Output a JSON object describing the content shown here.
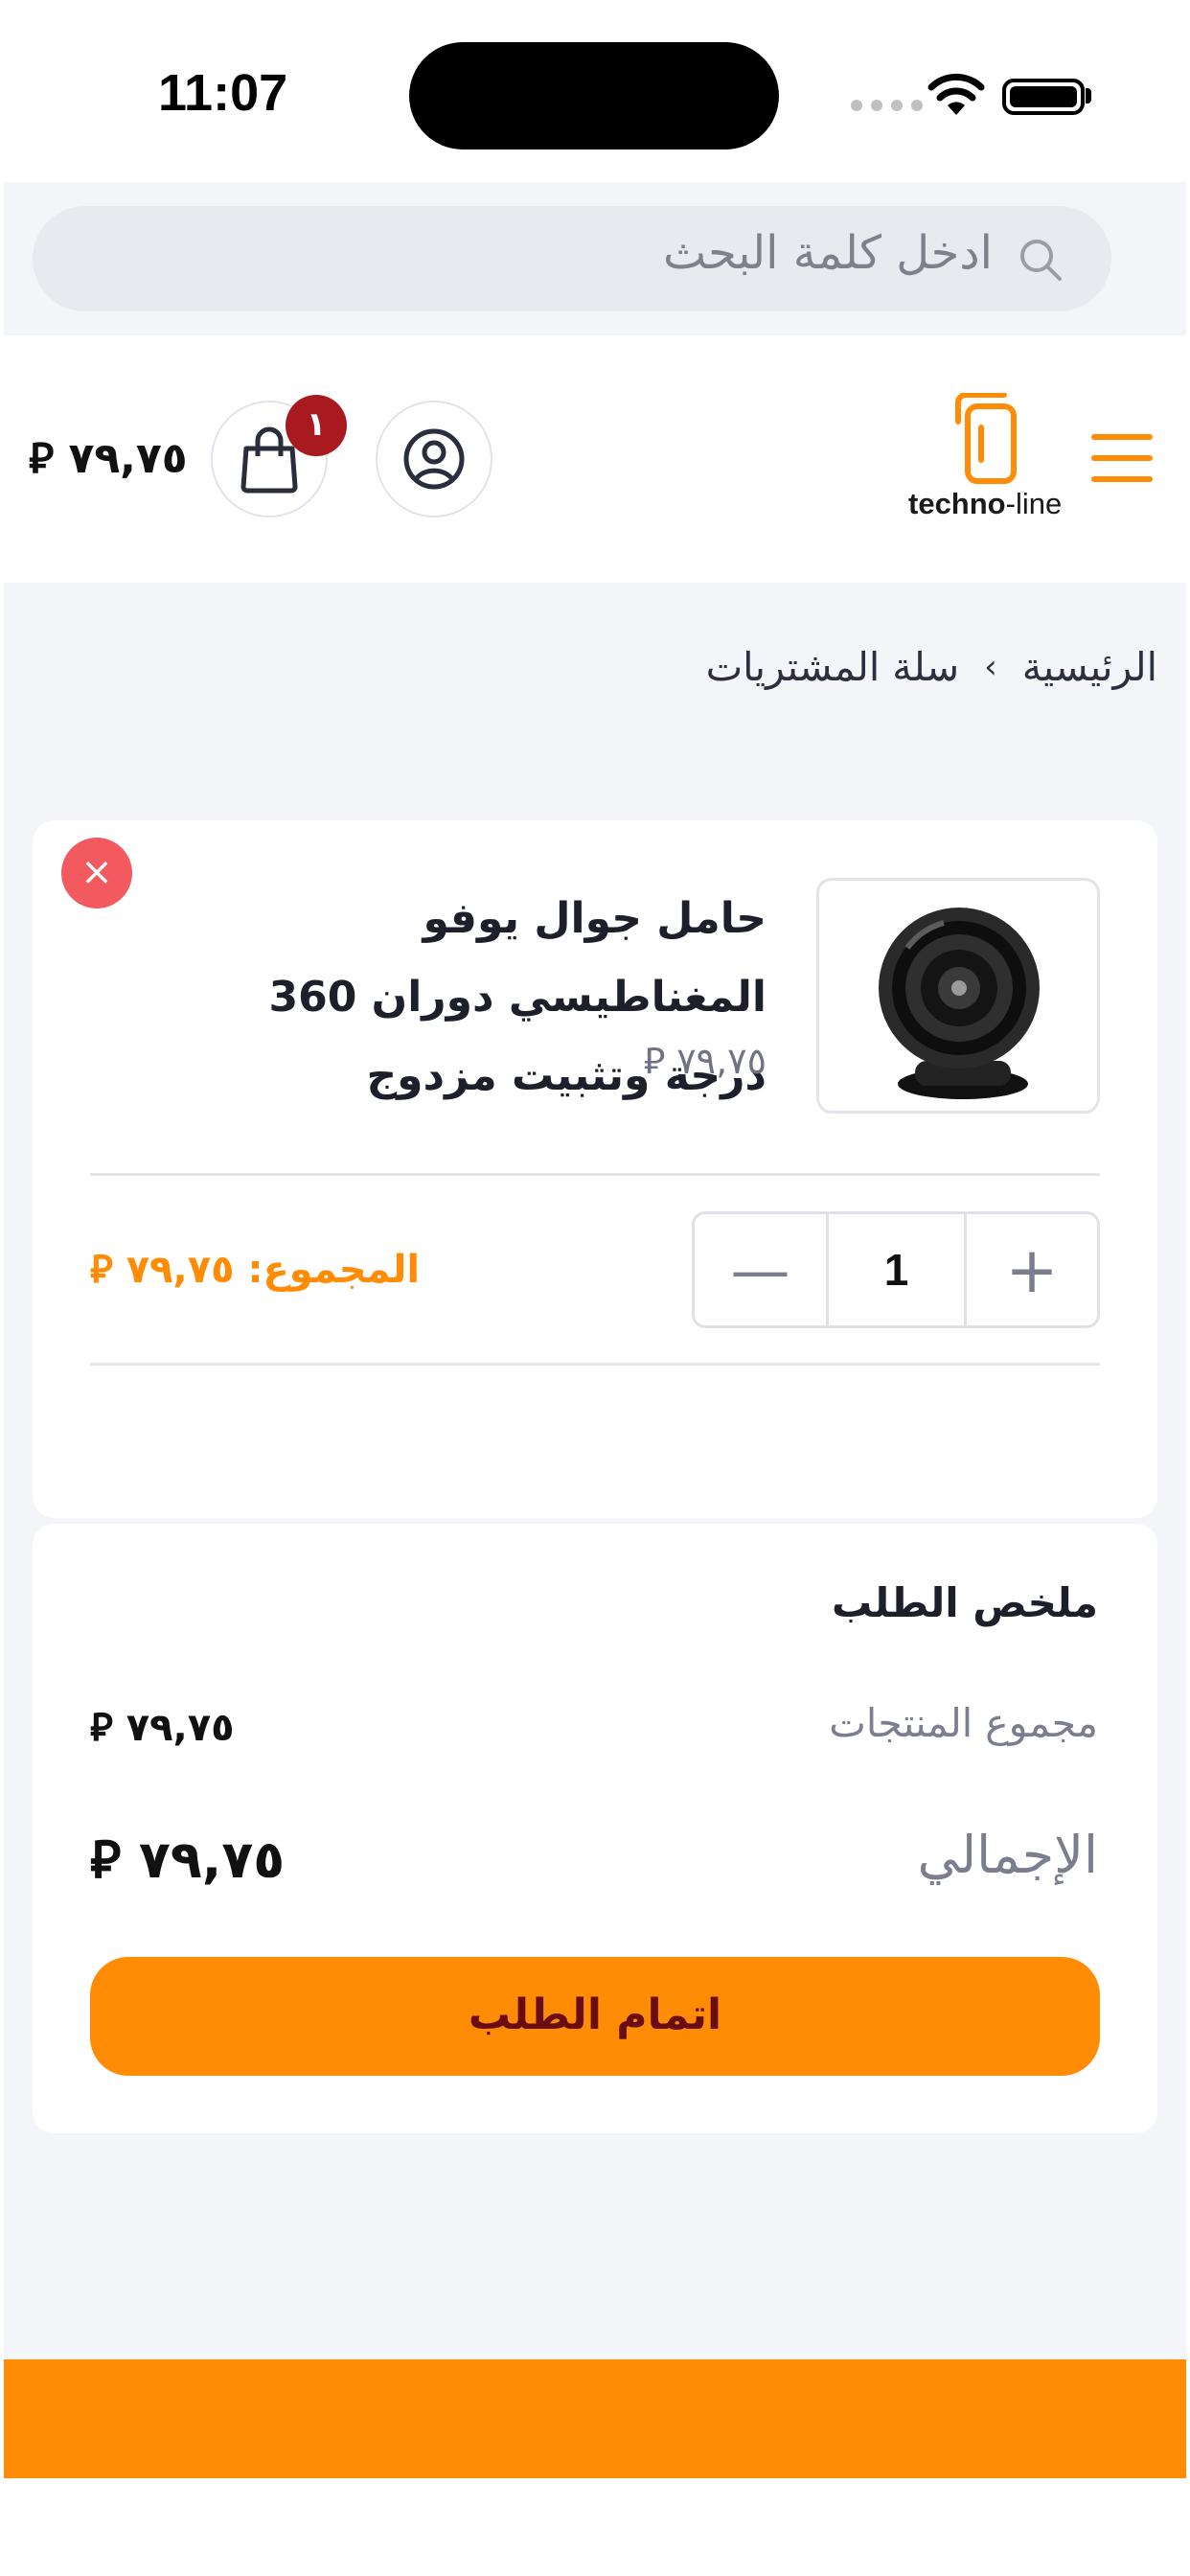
{
  "status_bar": {
    "time": "11:07"
  },
  "search": {
    "placeholder": "ادخل كلمة البحث"
  },
  "header": {
    "logo_brand": "techno",
    "logo_suffix": "-line",
    "cart_count": "١",
    "cart_total": "٧٩,٧٥ ⃁"
  },
  "breadcrumb": {
    "home": "الرئيسية",
    "separator": "›",
    "current": "سلة المشتريات"
  },
  "cart": {
    "remove_symbol": "×",
    "item": {
      "name": "حامل جوال يوفو المغناطيسي دوران 360 درجة وتثبيت مزدوج",
      "price": "٧٩,٧٥ ⃁",
      "quantity": "1",
      "line_total": "المجموع: ٧٩,٧٥ ⃁"
    },
    "minus_symbol": "—",
    "plus_symbol": "+"
  },
  "summary": {
    "title": "ملخص الطلب",
    "subtotal_label": "مجموع المنتجات",
    "subtotal_value": "٧٩,٧٥ ⃁",
    "total_label": "الإجمالي",
    "total_value": "٧٩,٧٥ ⃁",
    "checkout_label": "اتمام الطلب"
  },
  "colors": {
    "accent": "#ff8c04",
    "badge": "#a81a1f",
    "remove": "#f25a5f"
  }
}
